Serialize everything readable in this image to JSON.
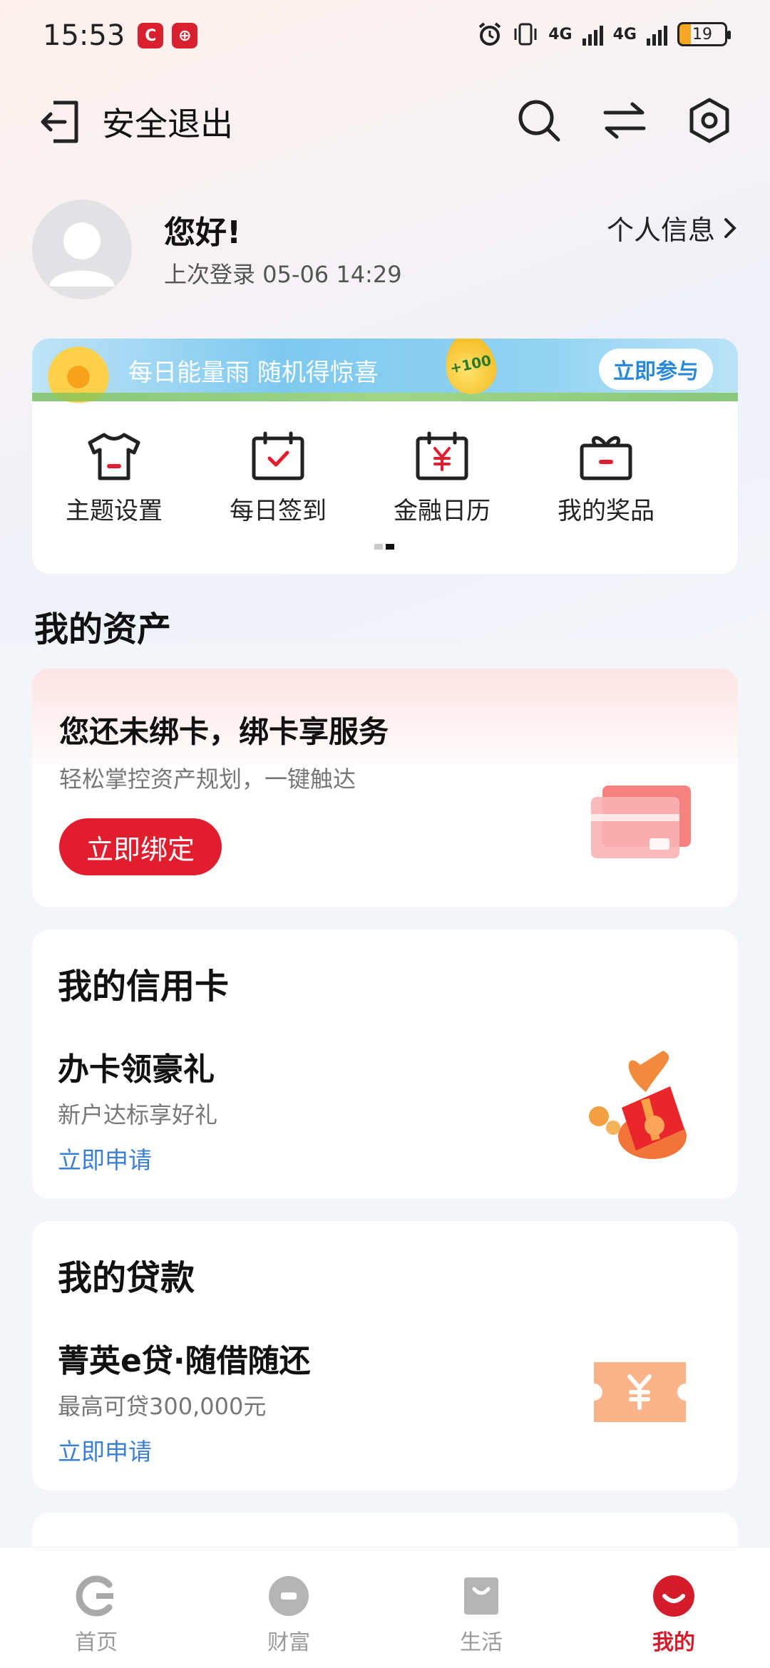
{
  "status_bar": {
    "time": "15:53",
    "network_1": "4G",
    "network_2": "4G",
    "battery": "19"
  },
  "header": {
    "logout_label": "安全退出"
  },
  "profile": {
    "greeting": "您好!",
    "last_login": "上次登录 05-06 14:29",
    "personal_info_label": "个人信息"
  },
  "promo": {
    "banner_text": "每日能量雨 随机得惊喜",
    "badge": "+100",
    "join_label": "立即参与"
  },
  "quick_actions": [
    {
      "label": "主题设置",
      "icon": "tshirt-icon"
    },
    {
      "label": "每日签到",
      "icon": "calendar-check-icon"
    },
    {
      "label": "金融日历",
      "icon": "calendar-yuan-icon"
    },
    {
      "label": "我的奖品",
      "icon": "gift-box-icon"
    }
  ],
  "assets": {
    "section_title": "我的资产",
    "bind_title": "您还未绑卡，绑卡享服务",
    "bind_subtitle": "轻松掌控资产规划，一键触达",
    "bind_button": "立即绑定"
  },
  "credit": {
    "heading": "我的信用卡",
    "title": "办卡领豪礼",
    "subtitle": "新户达标享好礼",
    "link": "立即申请"
  },
  "loan": {
    "heading": "我的贷款",
    "title": "菁英e贷·随借随还",
    "subtitle": "最高可贷300,000元",
    "link": "立即申请"
  },
  "tabbar": {
    "items": [
      {
        "label": "首页",
        "icon": "home-logo-icon",
        "active": false
      },
      {
        "label": "财富",
        "icon": "wealth-icon",
        "active": false
      },
      {
        "label": "生活",
        "icon": "life-bag-icon",
        "active": false
      },
      {
        "label": "我的",
        "icon": "me-smile-icon",
        "active": true
      }
    ]
  },
  "colors": {
    "brand_red": "#e21d2e",
    "link_blue": "#3a7fd4",
    "tab_active": "#d41c2a"
  }
}
